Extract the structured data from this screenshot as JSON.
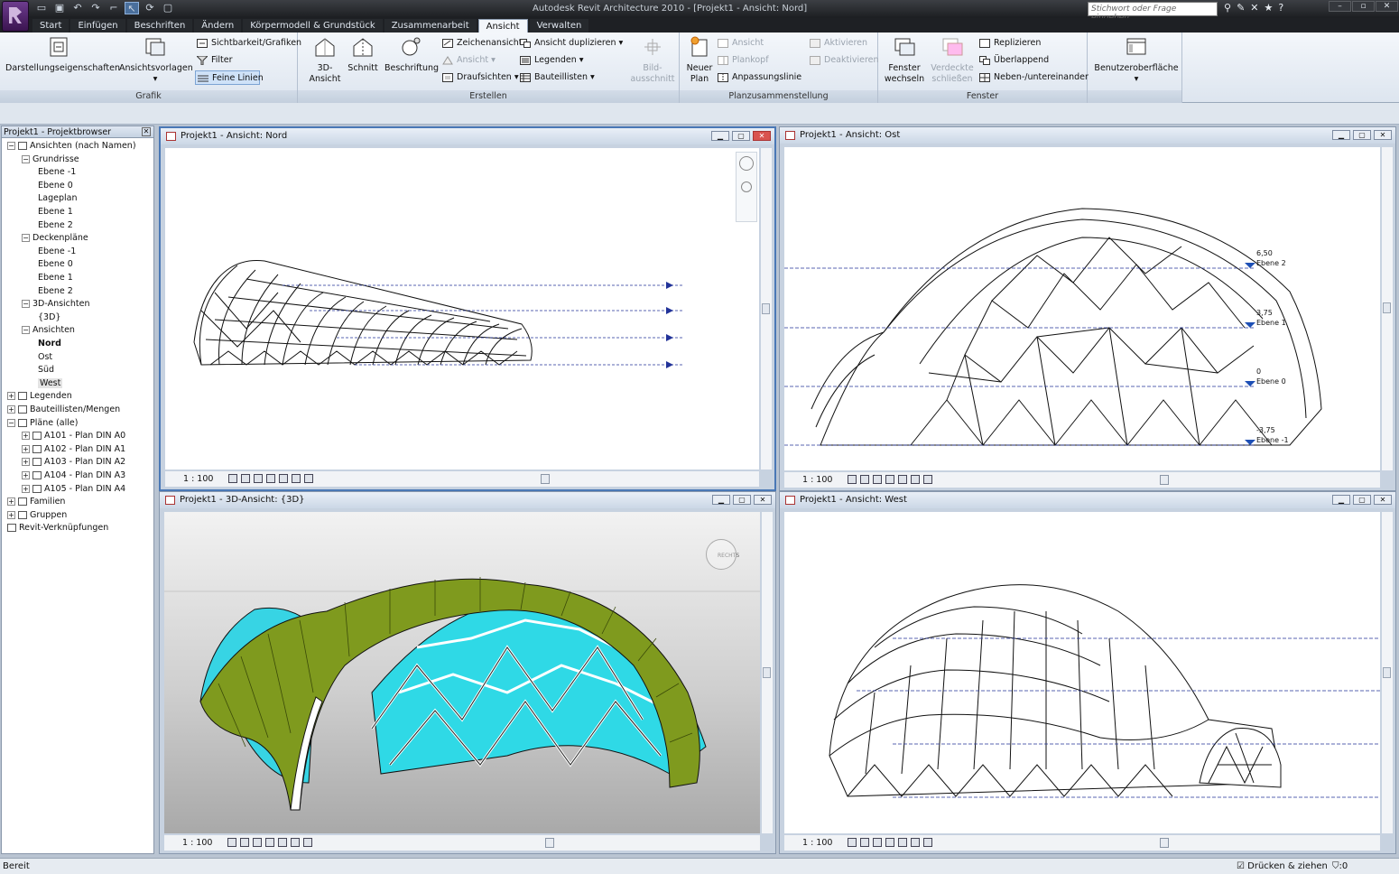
{
  "app": {
    "title": "Autodesk Revit Architecture 2010 - [Projekt1 - Ansicht: Nord]",
    "search_placeholder": "Stichwort oder Frage eingeben"
  },
  "tabs": [
    "Start",
    "Einfügen",
    "Beschriften",
    "Ändern",
    "Körpermodell & Grundstück",
    "Zusammenarbeit",
    "Ansicht",
    "Verwalten"
  ],
  "ribbon": {
    "grafik": {
      "title": "Grafik",
      "darstellung": "Darstellungseigenschaften",
      "ansichtsvorlagen": "Ansichtsvorlagen",
      "sichtbarkeit": "Sichtbarkeit/Grafiken",
      "filter": "Filter",
      "feine_linien": "Feine Linien"
    },
    "erstellen": {
      "title": "Erstellen",
      "ansicht3d_1": "3D-",
      "ansicht3d_2": "Ansicht",
      "schnitt": "Schnitt",
      "beschriftung": "Beschriftung",
      "zeichenansicht": "Zeichenansicht",
      "ansicht": "Ansicht",
      "draufsichten": "Draufsichten",
      "ansicht_duplizieren": "Ansicht duplizieren",
      "legenden": "Legenden",
      "bauteillisten": "Bauteillisten",
      "bildausschnitt_1": "Bild-",
      "bildausschnitt_2": "ausschnitt"
    },
    "planzusammenstellung": {
      "title": "Planzusammenstellung",
      "neuer_plan_1": "Neuer",
      "neuer_plan_2": "Plan",
      "ansicht": "Ansicht",
      "plankopf": "Plankopf",
      "anpassungslinie": "Anpassungslinie",
      "aktivieren": "Aktivieren",
      "deaktivieren": "Deaktivieren"
    },
    "fenster": {
      "title": "Fenster",
      "fenster_wechseln_1": "Fenster",
      "fenster_wechseln_2": "wechseln",
      "verdeckte_1": "Verdeckte",
      "verdeckte_2": "schließen",
      "replizieren": "Replizieren",
      "ueberlappend": "Überlappend",
      "nebeneinander": "Neben-/untereinander"
    },
    "benutzeroberflaeche": "Benutzeroberfläche"
  },
  "browser": {
    "title": "Projekt1 - Projektbrowser",
    "nodes": [
      {
        "label": "Ansichten (nach Namen)",
        "level": 0,
        "exp": "−"
      },
      {
        "label": "Grundrisse",
        "level": 1,
        "exp": "−"
      },
      {
        "label": "Ebene -1",
        "level": 2
      },
      {
        "label": "Ebene 0",
        "level": 2
      },
      {
        "label": "Lageplan",
        "level": 2
      },
      {
        "label": "Ebene 1",
        "level": 2
      },
      {
        "label": "Ebene 2",
        "level": 2
      },
      {
        "label": "Deckenpläne",
        "level": 1,
        "exp": "−"
      },
      {
        "label": "Ebene -1",
        "level": 2
      },
      {
        "label": "Ebene 0",
        "level": 2
      },
      {
        "label": "Ebene 1",
        "level": 2
      },
      {
        "label": "Ebene 2",
        "level": 2
      },
      {
        "label": "3D-Ansichten",
        "level": 1,
        "exp": "−"
      },
      {
        "label": "{3D}",
        "level": 2
      },
      {
        "label": "Ansichten",
        "level": 1,
        "exp": "−"
      },
      {
        "label": "Nord",
        "level": 2,
        "bold": true
      },
      {
        "label": "Ost",
        "level": 2
      },
      {
        "label": "Süd",
        "level": 2
      },
      {
        "label": "West",
        "level": 2,
        "hl": true
      },
      {
        "label": "Legenden",
        "level": 0,
        "exp": "+"
      },
      {
        "label": "Bauteillisten/Mengen",
        "level": 0,
        "exp": "+"
      },
      {
        "label": "Pläne (alle)",
        "level": 0,
        "exp": "−"
      },
      {
        "label": "A101 - Plan DIN A0",
        "level": 1,
        "exp": "+"
      },
      {
        "label": "A102 - Plan DIN A1",
        "level": 1,
        "exp": "+"
      },
      {
        "label": "A103 - Plan DIN A2",
        "level": 1,
        "exp": "+"
      },
      {
        "label": "A104 - Plan DIN A3",
        "level": 1,
        "exp": "+"
      },
      {
        "label": "A105 - Plan DIN A4",
        "level": 1,
        "exp": "+"
      },
      {
        "label": "Familien",
        "level": 0,
        "exp": "+"
      },
      {
        "label": "Gruppen",
        "level": 0,
        "exp": "+"
      },
      {
        "label": "Revit-Verknüpfungen",
        "level": 0
      }
    ]
  },
  "views": {
    "nord": {
      "title": "Projekt1 - Ansicht: Nord",
      "scale": "1 : 100"
    },
    "ost": {
      "title": "Projekt1 - Ansicht: Ost",
      "scale": "1 : 100",
      "levels": [
        {
          "value": "6,50",
          "name": "Ebene 2"
        },
        {
          "value": "3,75",
          "name": "Ebene 1"
        },
        {
          "value": "0",
          "name": "Ebene 0"
        },
        {
          "value": "-3,75",
          "name": "Ebene -1"
        }
      ]
    },
    "drei_d": {
      "title": "Projekt1 - 3D-Ansicht: {3D}",
      "scale": "1 : 100",
      "viewcube": "RECHTS"
    },
    "west": {
      "title": "Projekt1 - Ansicht: West",
      "scale": "1 : 100"
    }
  },
  "status": {
    "left": "Bereit",
    "drag": "Drücken & ziehen",
    "filter_count": ":0"
  }
}
